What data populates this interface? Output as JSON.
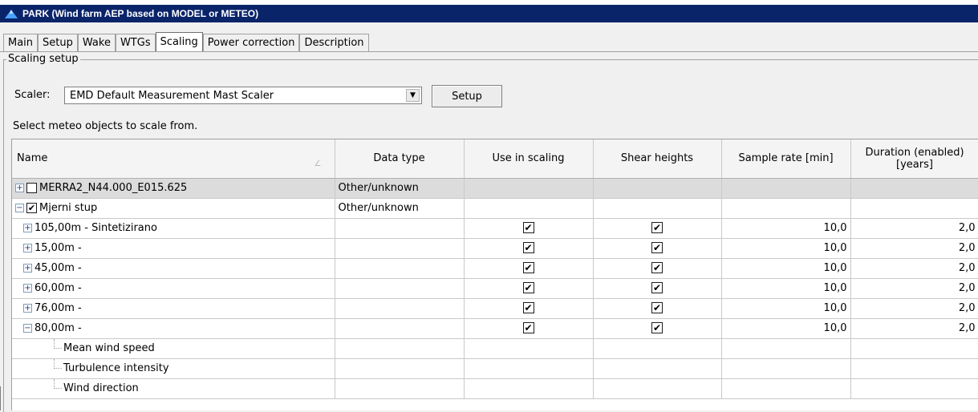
{
  "window": {
    "title": "PARK (Wind farm AEP based on MODEL or METEO)",
    "icon": "park-turbine-icon"
  },
  "tabs": [
    {
      "label": "Main",
      "active": false
    },
    {
      "label": "Setup",
      "active": false
    },
    {
      "label": "Wake",
      "active": false
    },
    {
      "label": "WTGs",
      "active": false
    },
    {
      "label": "Scaling",
      "active": true
    },
    {
      "label": "Power correction",
      "active": false
    },
    {
      "label": "Description",
      "active": false
    }
  ],
  "scaling": {
    "group_label": "Scaling setup",
    "scaler_label": "Scaler:",
    "scaler_value": "EMD Default Measurement Mast Scaler",
    "setup_button": "Setup",
    "select_hint": "Select meteo objects to scale from."
  },
  "grid": {
    "columns": {
      "name": "Name",
      "data_type": "Data type",
      "use_in_scaling": "Use in scaling",
      "shear_heights": "Shear heights",
      "sample_rate": "Sample rate [min]",
      "duration": "Duration (enabled) [years]"
    },
    "rows": [
      {
        "name": "MERRA2_N44.000_E015.625",
        "data_type": "Other/unknown",
        "checked": false
      },
      {
        "name": "Mjerni stup",
        "data_type": "Other/unknown",
        "checked": true
      },
      {
        "name": "105,00m - Sintetizirano",
        "sample_rate": "10,0",
        "duration": "2,0"
      },
      {
        "name": "15,00m -",
        "sample_rate": "10,0",
        "duration": "2,0"
      },
      {
        "name": "45,00m -",
        "sample_rate": "10,0",
        "duration": "2,0"
      },
      {
        "name": "60,00m -",
        "sample_rate": "10,0",
        "duration": "2,0"
      },
      {
        "name": "76,00m -",
        "sample_rate": "10,0",
        "duration": "2,0"
      },
      {
        "name": "80,00m -",
        "sample_rate": "10,0",
        "duration": "2,0"
      },
      {
        "name": "Mean wind speed"
      },
      {
        "name": "Turbulence intensity"
      },
      {
        "name": "Wind direction"
      }
    ]
  },
  "colors": {
    "titlebar": "#0a246a",
    "row_highlight": "#dcdcdc"
  }
}
